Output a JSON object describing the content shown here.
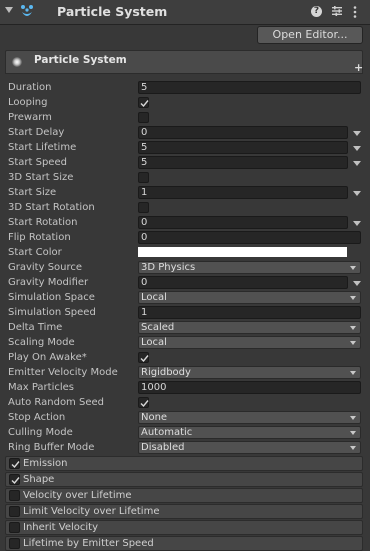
{
  "header": {
    "title": "Particle System",
    "help": "?",
    "icon": "particle-system-icon"
  },
  "open_editor": {
    "label": "Open Editor..."
  },
  "panel": {
    "title": "Particle System",
    "plus": "+"
  },
  "properties": [
    {
      "label": "Duration",
      "kind": "text",
      "value": "5"
    },
    {
      "label": "Looping",
      "kind": "check",
      "checked": true
    },
    {
      "label": "Prewarm",
      "kind": "check",
      "checked": false
    },
    {
      "label": "Start Delay",
      "kind": "curve",
      "value": "0"
    },
    {
      "label": "Start Lifetime",
      "kind": "curve",
      "value": "5"
    },
    {
      "label": "Start Speed",
      "kind": "curve",
      "value": "5"
    },
    {
      "label": "3D Start Size",
      "kind": "check",
      "checked": false
    },
    {
      "label": "Start Size",
      "kind": "curve",
      "value": "1"
    },
    {
      "label": "3D Start Rotation",
      "kind": "check",
      "checked": false
    },
    {
      "label": "Start Rotation",
      "kind": "curve",
      "value": "0"
    },
    {
      "label": "Flip Rotation",
      "kind": "text",
      "value": "0"
    },
    {
      "label": "Start Color",
      "kind": "color",
      "value": "#ffffff"
    },
    {
      "label": "Gravity Source",
      "kind": "dropdown",
      "value": "3D Physics"
    },
    {
      "label": "Gravity Modifier",
      "kind": "curve",
      "value": "0"
    },
    {
      "label": "Simulation Space",
      "kind": "dropdown",
      "value": "Local"
    },
    {
      "label": "Simulation Speed",
      "kind": "text",
      "value": "1"
    },
    {
      "label": "Delta Time",
      "kind": "dropdown",
      "value": "Scaled"
    },
    {
      "label": "Scaling Mode",
      "kind": "dropdown",
      "value": "Local"
    },
    {
      "label": "Play On Awake*",
      "kind": "check",
      "checked": true
    },
    {
      "label": "Emitter Velocity Mode",
      "kind": "dropdown",
      "value": "Rigidbody"
    },
    {
      "label": "Max Particles",
      "kind": "text",
      "value": "1000"
    },
    {
      "label": "Auto Random Seed",
      "kind": "check",
      "checked": true
    },
    {
      "label": "Stop Action",
      "kind": "dropdown",
      "value": "None"
    },
    {
      "label": "Culling Mode",
      "kind": "dropdown",
      "value": "Automatic"
    },
    {
      "label": "Ring Buffer Mode",
      "kind": "dropdown",
      "value": "Disabled"
    }
  ],
  "modules": [
    {
      "label": "Emission",
      "checked": true
    },
    {
      "label": "Shape",
      "checked": true
    },
    {
      "label": "Velocity over Lifetime",
      "checked": false
    },
    {
      "label": "Limit Velocity over Lifetime",
      "checked": false
    },
    {
      "label": "Inherit Velocity",
      "checked": false
    },
    {
      "label": "Lifetime by Emitter Speed",
      "checked": false
    }
  ]
}
